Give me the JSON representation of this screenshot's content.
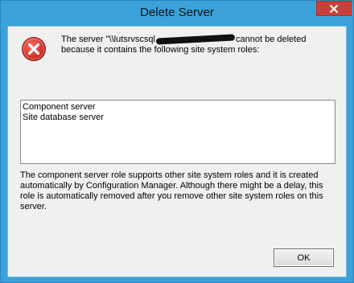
{
  "window": {
    "title": "Delete Server",
    "close_icon": "close-icon"
  },
  "dialog": {
    "icon": "error-icon",
    "message_prefix": "The server \"\\\\lutsrvscsql",
    "message_suffix": "cannot be deleted because it contains the following site system roles:",
    "roles": [
      "Component server",
      "Site database server"
    ],
    "info": "The component server role supports other site system roles and it is created automatically by Configuration Manager. Although there might be a delay, this role is automatically removed after you remove other site system roles on this server.",
    "ok_label": "OK"
  },
  "colors": {
    "frame": "#3aa2d9",
    "close_button": "#c7413a",
    "client": "#f0f0f0",
    "error_icon": "#d9302b"
  }
}
